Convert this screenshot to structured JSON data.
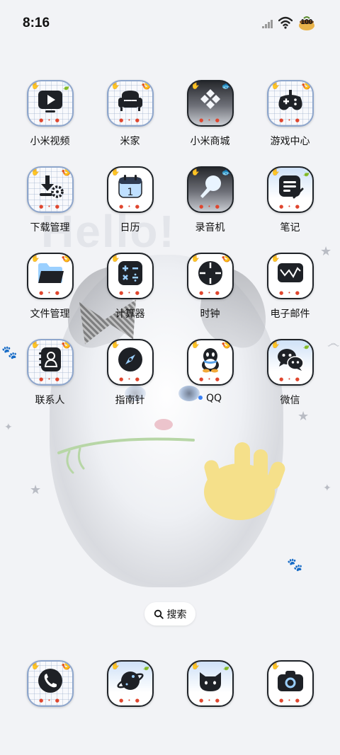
{
  "status_bar": {
    "time": "8:16",
    "battery": "100"
  },
  "wallpaper": {
    "text": "Hello!"
  },
  "apps": [
    {
      "label": "小米视频",
      "icon": "play-video-icon",
      "style": "check",
      "tag": "🍃"
    },
    {
      "label": "米家",
      "icon": "sofa-icon",
      "style": "check",
      "tag": "🍤"
    },
    {
      "label": "小米商城",
      "icon": "store-logo-icon",
      "style": "dark",
      "tag": "🐟"
    },
    {
      "label": "游戏中心",
      "icon": "gamepad-icon",
      "style": "check",
      "tag": "🍤"
    },
    {
      "label": "下载管理",
      "icon": "download-icon",
      "style": "check",
      "tag": "🍤"
    },
    {
      "label": "日历",
      "icon": "calendar-icon",
      "style": "plain",
      "tag": "",
      "glyph_text": "1"
    },
    {
      "label": "录音机",
      "icon": "microphone-icon",
      "style": "dark",
      "tag": "🐟"
    },
    {
      "label": "笔记",
      "icon": "notes-icon",
      "style": "sky",
      "tag": "🍃"
    },
    {
      "label": "文件管理",
      "icon": "folder-icon",
      "style": "plain",
      "tag": "🍤"
    },
    {
      "label": "计算器",
      "icon": "calculator-icon",
      "style": "plain",
      "tag": ""
    },
    {
      "label": "时钟",
      "icon": "clock-icon",
      "style": "plain",
      "tag": "🍤"
    },
    {
      "label": "电子邮件",
      "icon": "mail-icon",
      "style": "plain",
      "tag": ""
    },
    {
      "label": "联系人",
      "icon": "contacts-icon",
      "style": "check",
      "tag": "🍤"
    },
    {
      "label": "指南针",
      "icon": "compass-icon",
      "style": "plain",
      "tag": ""
    },
    {
      "label": "QQ",
      "icon": "qq-penguin-icon",
      "style": "plain",
      "tag": "🍤",
      "new_dot": true
    },
    {
      "label": "微信",
      "icon": "wechat-icon",
      "style": "sky",
      "tag": "🍃"
    }
  ],
  "search": {
    "label": "搜索"
  },
  "dock": [
    {
      "icon": "phone-icon",
      "style": "check",
      "tag": "🍤"
    },
    {
      "icon": "browser-planet-icon",
      "style": "sky",
      "tag": "🍃"
    },
    {
      "icon": "cat-face-icon",
      "style": "sky",
      "tag": "🍃"
    },
    {
      "icon": "camera-icon",
      "style": "plain",
      "tag": ""
    }
  ],
  "colors": {
    "background": "#f2f3f6",
    "icon_border": "#1f2328",
    "new_dot": "#3b82f6",
    "paw": "#f5e08a"
  }
}
